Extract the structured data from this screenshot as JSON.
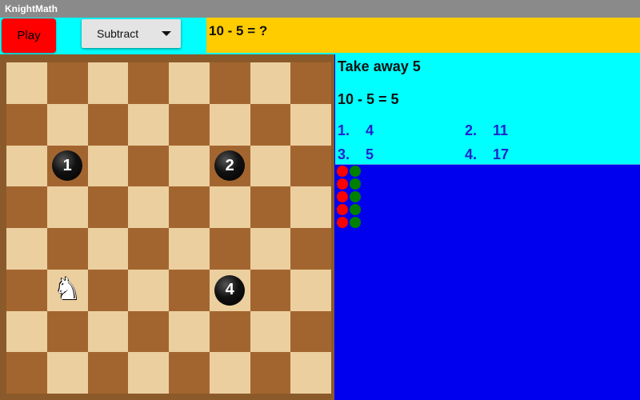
{
  "window": {
    "title": "KnightMath"
  },
  "toolbar": {
    "play_label": "Play",
    "operation_selected": "Subtract",
    "question": "10 - 5 = ?"
  },
  "board": {
    "size": 8,
    "knight": {
      "col": 1,
      "row": 5
    },
    "targets": [
      {
        "label": "1",
        "col": 1,
        "row": 2
      },
      {
        "label": "2",
        "col": 5,
        "row": 2
      },
      {
        "label": "4",
        "col": 5,
        "row": 5
      }
    ]
  },
  "panel": {
    "prompt": "Take away 5",
    "equation": "10 - 5 = 5",
    "answers": [
      {
        "text": "1.    4"
      },
      {
        "text": "2.    11"
      },
      {
        "text": "3.    5"
      },
      {
        "text": "4.    17"
      }
    ]
  },
  "score_dots": {
    "wrong_color": "#ff0000",
    "right_color": "#008000",
    "rows": 5
  },
  "colors": {
    "background": "#0000ee",
    "toolbar": "#00ffff",
    "question_bar": "#ffcc00",
    "answer_text": "#2222cc"
  }
}
